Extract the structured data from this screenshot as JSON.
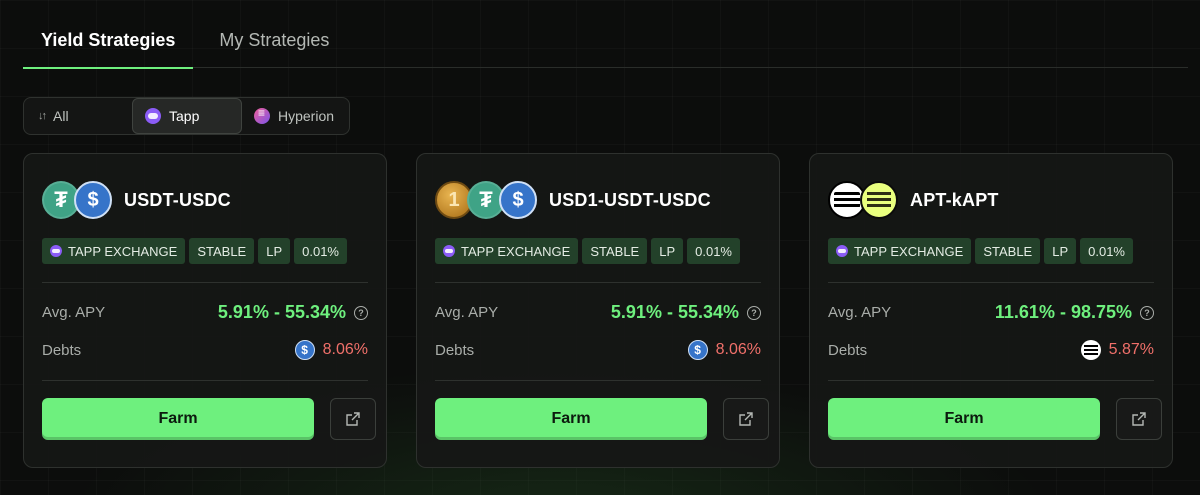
{
  "tabs": [
    {
      "label": "Yield Strategies",
      "active": true
    },
    {
      "label": "My Strategies",
      "active": false
    }
  ],
  "filters": [
    {
      "label": "All",
      "icon": "sort-icon"
    },
    {
      "label": "Tapp",
      "icon": "tapp-logo-icon",
      "active": true
    },
    {
      "label": "Hyperion",
      "icon": "hyperion-logo-icon"
    }
  ],
  "accent_color": "#6ef07e",
  "debt_color": "#f0706a",
  "cards": [
    {
      "pair": "USDT-USDC",
      "coins": [
        "usdt-icon",
        "usdc-icon"
      ],
      "tags": [
        "TAPP EXCHANGE",
        "STABLE",
        "LP",
        "0.01%"
      ],
      "apy_label": "Avg. APY",
      "apy": "5.91% - 55.34%",
      "debts_label": "Debts",
      "debt_coin": "usdc-icon",
      "debt": "8.06%",
      "farm_label": "Farm"
    },
    {
      "pair": "USD1-USDT-USDC",
      "coins": [
        "usd1-icon",
        "usdt-icon",
        "usdc-icon"
      ],
      "tags": [
        "TAPP EXCHANGE",
        "STABLE",
        "LP",
        "0.01%"
      ],
      "apy_label": "Avg. APY",
      "apy": "5.91% - 55.34%",
      "debts_label": "Debts",
      "debt_coin": "usdc-icon",
      "debt": "8.06%",
      "farm_label": "Farm"
    },
    {
      "pair": "APT-kAPT",
      "coins": [
        "apt-icon",
        "kapt-icon"
      ],
      "tags": [
        "TAPP EXCHANGE",
        "STABLE",
        "LP",
        "0.01%"
      ],
      "apy_label": "Avg. APY",
      "apy": "11.61% - 98.75%",
      "debts_label": "Debts",
      "debt_coin": "apt-icon",
      "debt": "5.87%",
      "farm_label": "Farm"
    }
  ]
}
